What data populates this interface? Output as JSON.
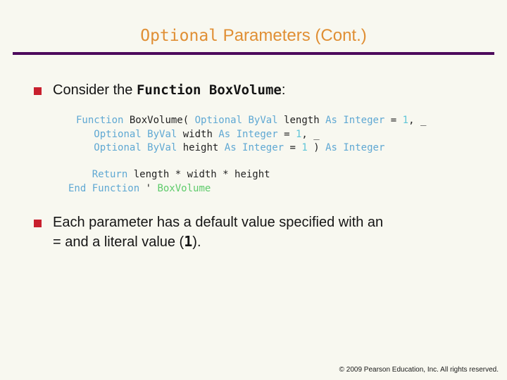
{
  "slide": {
    "background_color": "#f8f8f0",
    "title": {
      "mono_part": "Optional",
      "sans_part": " Parameters (Cont.)",
      "color": "#e08f34"
    },
    "rule_color": "#4d0a5c",
    "bullet_marker_color": "#c8202e"
  },
  "bullets": [
    {
      "lead": "Consider the ",
      "code": "Function BoxVolume",
      "tail": ":"
    },
    {
      "line1": "Each parameter has a default value specified with an",
      "line2_pre": "= and a literal value (",
      "line2_literal": "1",
      "line2_post": ")."
    }
  ],
  "code": {
    "signature": {
      "line1": {
        "kw_function": "Function",
        "name": " BoxVolume( ",
        "kw_optional": "Optional",
        "space1": " ",
        "kw_byval": "ByVal",
        "param": " length ",
        "kw_as": "As",
        "kw_integer": " Integer",
        "eq": " = ",
        "num": "1",
        "cont": ", _"
      },
      "line2": {
        "indent": "   ",
        "kw_optional": "Optional",
        "space1": " ",
        "kw_byval": "ByVal",
        "param": " width ",
        "kw_as": "As",
        "kw_integer": " Integer",
        "eq": " = ",
        "num": "1",
        "cont": ", _"
      },
      "line3": {
        "indent": "   ",
        "kw_optional": "Optional",
        "space1": " ",
        "kw_byval": "ByVal",
        "param": " height ",
        "kw_as": "As",
        "kw_integer": " Integer",
        "eq": " = ",
        "num": "1",
        "close": " ) ",
        "kw_as2": "As",
        "kw_integer2": " Integer"
      }
    },
    "body": {
      "line1": {
        "indent": "    ",
        "kw_return": "Return",
        "expr": " length * width * height"
      },
      "line2": {
        "kw_end": "End Function",
        "tick": " ' ",
        "comment": "BoxVolume"
      }
    },
    "colors": {
      "keyword": "#5fa8d3",
      "number": "#5fc5d8",
      "comment": "#5ecb6b",
      "identifier": "#222222"
    }
  },
  "footer": {
    "text": "© 2009 Pearson Education, Inc.  All rights reserved."
  }
}
